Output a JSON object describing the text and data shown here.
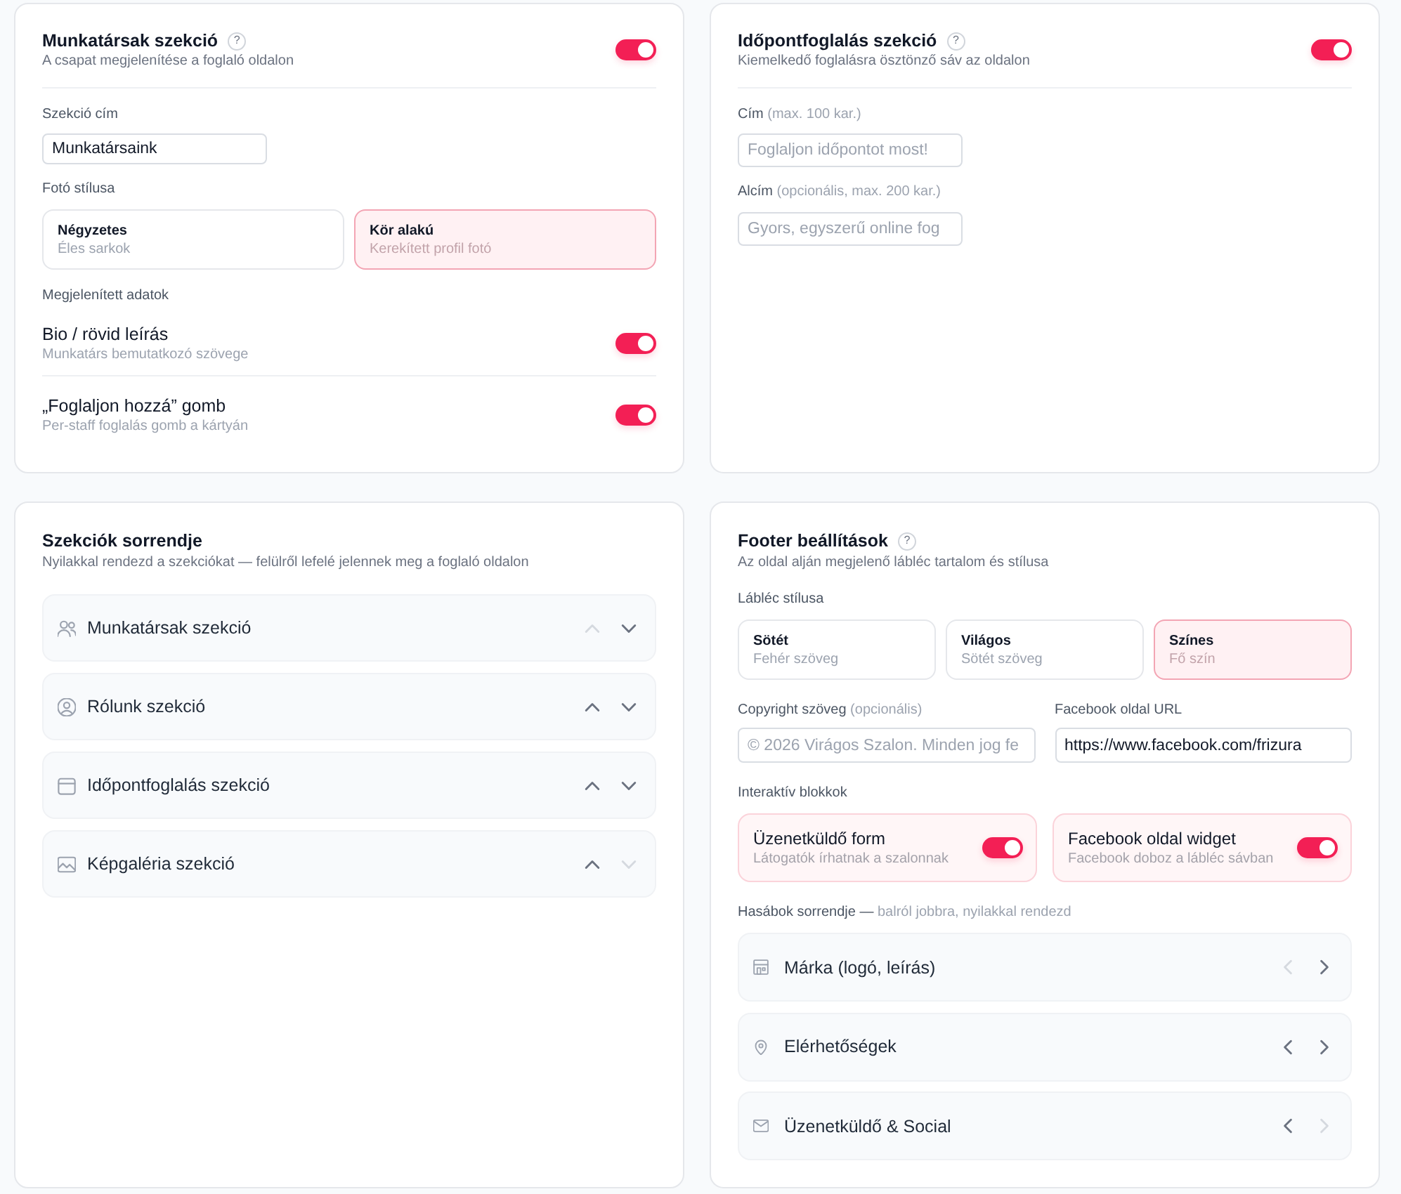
{
  "staff_section": {
    "title": "Munkatársak szekció",
    "help": "?",
    "subtitle": "A csapat megjelenítése a foglaló oldalon",
    "enabled": true,
    "title_field": {
      "label": "Szekció cím",
      "value": "Munkatársaink"
    },
    "photo_style": {
      "label": "Fotó stílusa",
      "options": [
        {
          "title": "Négyzetes",
          "subtitle": "Éles sarkok",
          "selected": false
        },
        {
          "title": "Kör alakú",
          "subtitle": "Kerekített profil fotó",
          "selected": true
        }
      ]
    },
    "displayed_data": {
      "label": "Megjelenített adatok",
      "items": [
        {
          "title": "Bio / rövid leírás",
          "subtitle": "Munkatárs bemutatkozó szövege",
          "on": true
        },
        {
          "title": "„Foglaljon hozzá” gomb",
          "subtitle": "Per-staff foglalás gomb a kártyán",
          "on": true
        }
      ]
    }
  },
  "booking_section": {
    "title": "Időpontfoglalás szekció",
    "help": "?",
    "subtitle": "Kiemelkedő foglalásra ösztönző sáv az oldalon",
    "enabled": true,
    "fields": [
      {
        "label": "Cím",
        "note": "(max. 100 kar.)",
        "placeholder": "Foglaljon időpontot most!"
      },
      {
        "label": "Alcím",
        "note": "(opcionális, max. 200 kar.)",
        "placeholder": "Gyors, egyszerű online fog"
      }
    ]
  },
  "section_order": {
    "title": "Szekciók sorrendje",
    "subtitle": "Nyilakkal rendezd a szekciókat — felülről lefelé jelennek meg a foglaló oldalon",
    "items": [
      {
        "kind": "staff",
        "label": "Munkatársak szekció",
        "up_disabled": true,
        "down_disabled": false
      },
      {
        "kind": "about",
        "label": "Rólunk szekció",
        "up_disabled": false,
        "down_disabled": false
      },
      {
        "kind": "booking",
        "label": "Időpontfoglalás szekció",
        "up_disabled": false,
        "down_disabled": false
      },
      {
        "kind": "gallery",
        "label": "Képgaléria szekció",
        "up_disabled": false,
        "down_disabled": true
      }
    ]
  },
  "footer": {
    "title": "Footer beállítások",
    "help": "?",
    "subtitle": "Az oldal alján megjelenő lábléc tartalom és stílusa",
    "style": {
      "label": "Lábléc stílusa",
      "options": [
        {
          "title": "Sötét",
          "subtitle": "Fehér szöveg",
          "selected": false
        },
        {
          "title": "Világos",
          "subtitle": "Sötét szöveg",
          "selected": false
        },
        {
          "title": "Színes",
          "subtitle": "Fő szín",
          "selected": true
        }
      ]
    },
    "fields": [
      {
        "label": "Copyright szöveg",
        "note": "(opcionális)",
        "placeholder": "© 2026 Virágos Szalon. Minden jog fe"
      },
      {
        "label": "Facebook oldal URL",
        "value": "https://www.facebook.com/frizura"
      }
    ],
    "blocks": {
      "label": "Interaktív blokkok",
      "items": [
        {
          "title": "Üzenetküldő form",
          "subtitle": "Látogatók írhatnak a szalonnak",
          "on": true
        },
        {
          "title": "Facebook oldal widget",
          "subtitle": "Facebook doboz a lábléc sávban",
          "on": true
        }
      ]
    },
    "columns": {
      "label": "Hasábok sorrendje —",
      "note": "balról jobbra, nyilakkal rendezd",
      "items": [
        {
          "kind": "brand",
          "label": "Márka (logó, leírás)",
          "left_disabled": true,
          "right_disabled": false
        },
        {
          "kind": "contact",
          "label": "Elérhetőségek",
          "left_disabled": false,
          "right_disabled": false
        },
        {
          "kind": "message",
          "label": "Üzenetküldő & Social",
          "left_disabled": false,
          "right_disabled": true
        }
      ]
    }
  }
}
